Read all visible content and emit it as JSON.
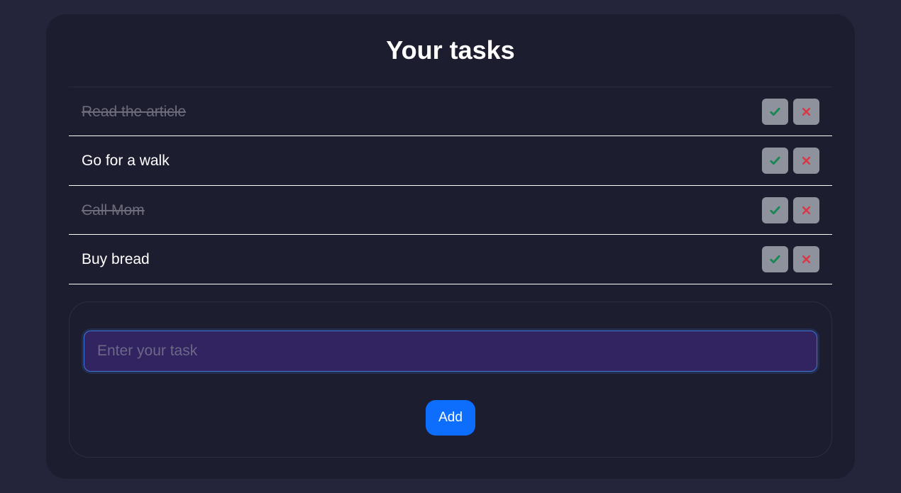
{
  "header": {
    "title": "Your tasks"
  },
  "tasks": [
    {
      "label": "Read the article",
      "done": true
    },
    {
      "label": "Go for a walk",
      "done": false
    },
    {
      "label": "Call Mom",
      "done": true
    },
    {
      "label": "Buy bread",
      "done": false
    }
  ],
  "form": {
    "placeholder": "Enter your task",
    "add_label": "Add"
  },
  "colors": {
    "page_bg": "#24243b",
    "card_bg": "#1d1d30",
    "input_bg": "#312461",
    "input_border": "#3d74d8",
    "add_btn": "#0d6efd",
    "check": "#198754",
    "cross": "#dc3545"
  }
}
